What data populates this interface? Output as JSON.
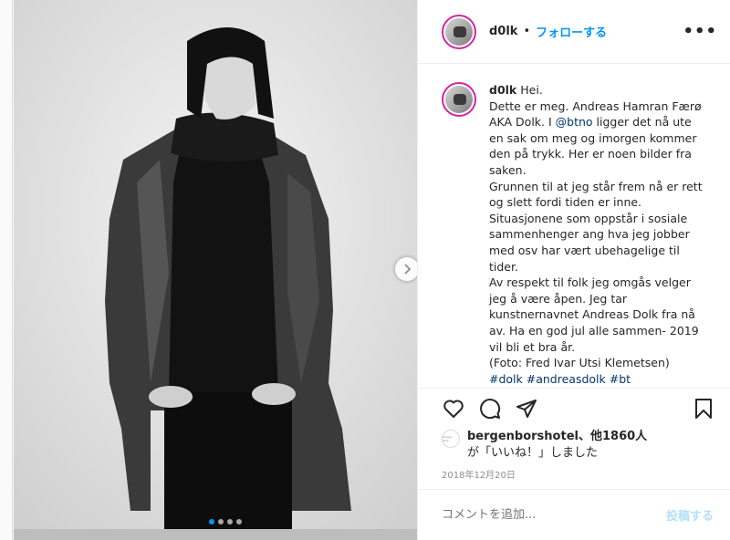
{
  "post": {
    "username": "d0lk",
    "separator": "•",
    "follow_label": "フォローする",
    "more_label": "•••",
    "caption": {
      "username": "d0lk",
      "lines": [
        "Hei.",
        "Dette er meg. Andreas Hamran Færø AKA Dolk. I",
        "@btno",
        "ligger det nå ute en sak om meg og imorgen kommer den på trykk. Her er noen bilder fra saken.",
        "Grunnen til at jeg står frem nå er rett og slett fordi tiden er inne.",
        "Situasjonene som oppstår i sosiale sammenhenger ang hva jeg jobber med osv har vært ubehagelige til tider.",
        "Av respekt til folk jeg omgås velger jeg å være åpen. Jeg tar kunstnernavnet Andreas Dolk fra nå av. Ha en god jul alle sammen- 2019 vil bli et bra år.",
        "(Foto: Fred Ivar Utsi Klemetsen)",
        "#dolk #andreasdolk #bt"
      ]
    },
    "likes": {
      "liker": "bergenborshotel",
      "others": "、他1860人",
      "suffix": "が「いいね！」しました",
      "avatar_text": "bergen børs"
    },
    "date": "2018年12月20日",
    "comment_placeholder": "コメントを追加...",
    "post_button": "投稿する",
    "carousel": {
      "slides": 4,
      "active_index": 0
    }
  },
  "colors": {
    "accent": "#0095f6",
    "link": "#00376b",
    "post_disabled": "#b2dffc",
    "avatar_ring": "#d6249f"
  },
  "icons": {
    "like": "heart-icon",
    "comment": "comment-icon",
    "share": "paper-plane-icon",
    "save": "bookmark-icon",
    "next": "chevron-right-icon"
  }
}
